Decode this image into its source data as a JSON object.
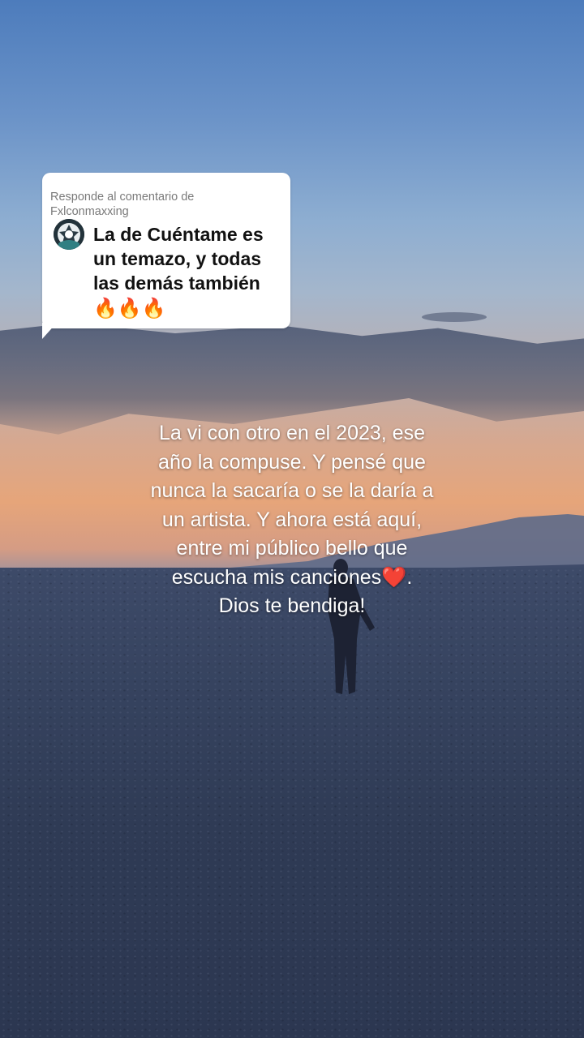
{
  "reply": {
    "header": "Responde al comentario de",
    "username": "Fxlconmaxxing",
    "comment": "La de Cuéntame es un temazo, y todas las demás también",
    "emojis": "🔥🔥🔥"
  },
  "caption": {
    "lines": [
      "La vi con otro en el 2023, ese",
      "año la compuse. Y pensé que",
      "nunca la sacaría o se la daría a",
      "un artista. Y ahora está aquí,",
      "entre mi público bello que",
      "escucha mis canciones",
      "Dios te bendiga!"
    ],
    "heart": "❤️",
    "line6_suffix": "."
  },
  "colors": {
    "sky_top": "#4d7cbc",
    "sunset": "#e6a57a",
    "ground": "#2f3b55",
    "card_bg": "#ffffff",
    "caption_text": "#ffffff"
  }
}
